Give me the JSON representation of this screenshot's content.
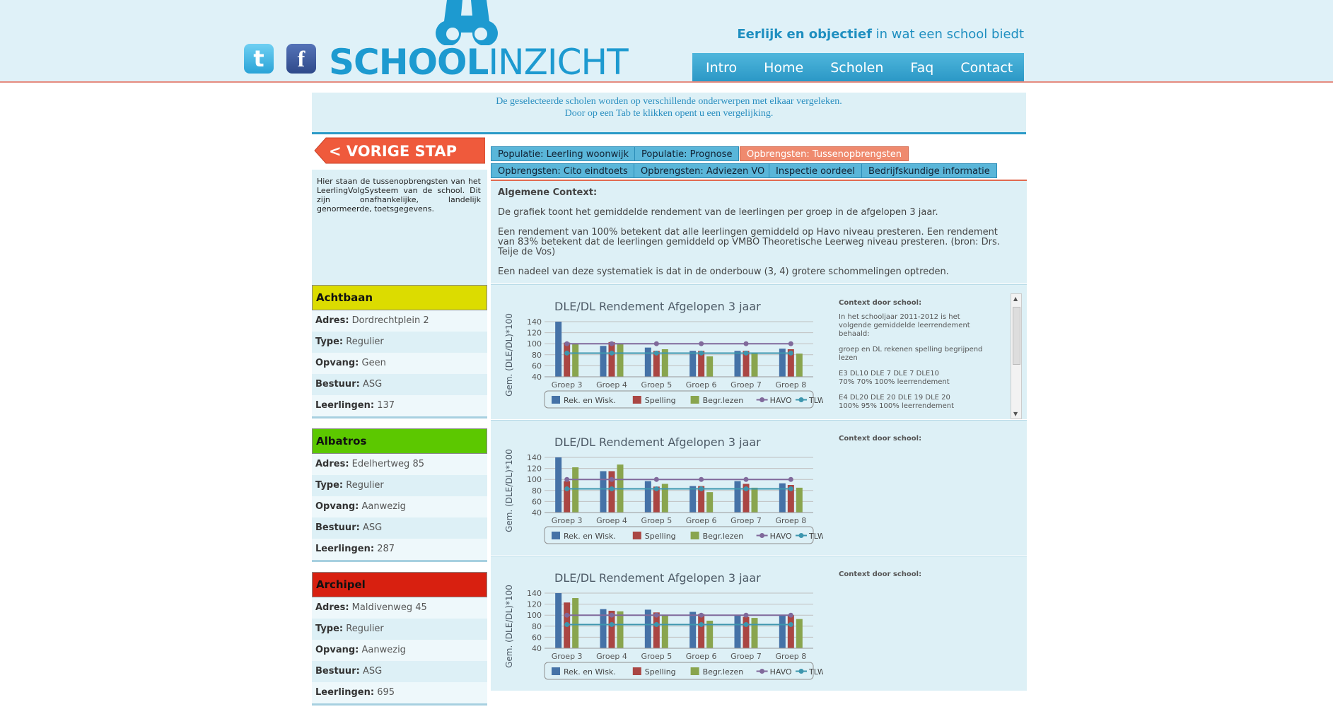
{
  "header": {
    "logo_bold": "SCHOOL",
    "logo_thin": "INZICHT",
    "tagline_bold": "Eerlijk en objectief",
    "tagline_rest": " in wat een school biedt",
    "nav": [
      "Intro",
      "Home",
      "Scholen",
      "Faq",
      "Contact"
    ],
    "social": [
      {
        "icon": "twitter-icon",
        "glyph": "t"
      },
      {
        "icon": "facebook-icon",
        "glyph": "f"
      }
    ],
    "brand_color": "#1d9ad0"
  },
  "intro": {
    "line1": "De geselecteerde scholen worden op verschillende onderwerpen met elkaar vergeleken.",
    "line2": "Door op een Tab te klikken opent u een vergelijking."
  },
  "sidebar": {
    "back_label": "<   VORIGE STAP",
    "description": "Hier staan de tussenopbrengsten van het LeerlingVolgSysteem van de school. Dit zijn onafhankelijke, landelijk genormeerde, toetsgegevens."
  },
  "labels": {
    "adres": "Adres:",
    "type": "Type:",
    "opvang": "Opvang:",
    "bestuur": "Bestuur:",
    "leerlingen": "Leerlingen:"
  },
  "schools": [
    {
      "name": "Achtbaan",
      "color": "#dcdc00",
      "adres": "Dordrechtplein 2",
      "type": "Regulier",
      "opvang": "Geen",
      "bestuur": "ASG",
      "leerlingen": "137"
    },
    {
      "name": "Albatros",
      "color": "#5cc800",
      "adres": "Edelhertweg 85",
      "type": "Regulier",
      "opvang": "Aanwezig",
      "bestuur": "ASG",
      "leerlingen": "287"
    },
    {
      "name": "Archipel",
      "color": "#d82010",
      "adres": "Maldivenweg 45",
      "type": "Regulier",
      "opvang": "Aanwezig",
      "bestuur": "ASG",
      "leerlingen": "695"
    }
  ],
  "tabs": [
    {
      "label": "Populatie: Leerling woonwijk",
      "active": false
    },
    {
      "label": "Populatie: Prognose",
      "active": false
    },
    {
      "label": "Opbrengsten: Tussenopbrengsten",
      "active": true
    },
    {
      "label": "Opbrengsten: Cito eindtoets",
      "active": false
    },
    {
      "label": "Opbrengsten: Adviezen VO",
      "active": false
    },
    {
      "label": "Inspectie oordeel",
      "active": false
    },
    {
      "label": "Bedrijfskundige informatie",
      "active": false
    }
  ],
  "context": {
    "title": "Algemene Context:",
    "p1": "De grafiek toont het gemiddelde rendement van de leerlingen per groep in de afgelopen 3 jaar.",
    "p2": "Een rendement van 100% betekent dat alle leerlingen gemiddeld op Havo niveau presteren. Een rendement van 83% betekent dat de leerlingen gemiddeld op VMBO Theoretische Leerweg niveau presteren. (bron: Drs. Teije de Vos)",
    "p3": "Een nadeel van deze systematiek is dat in de onderbouw (3, 4) grotere schommelingen optreden."
  },
  "school_context": {
    "title": "Context door school:",
    "lines": [
      "In het schooljaar 2011-2012 is het volgende gemiddelde leerrendement behaald:",
      "groep en DL rekenen spelling begrijpend lezen",
      "E3 DL10 DLE 7 DLE 7 DLE10\n70% 70% 100% leerrendement",
      "E4 DL20 DLE 20 DLE 19 DLE 20\n100% 95% 100% leerrendement"
    ]
  },
  "chart_data": [
    {
      "type": "bar",
      "title": "DLE/DL Rendement Afgelopen 3 jaar",
      "ylabel": "Gem. (DLE/DL)*100",
      "ylim": [
        40,
        140
      ],
      "yticks": [
        40,
        60,
        80,
        100,
        120,
        140
      ],
      "categories": [
        "Groep 3",
        "Groep 4",
        "Groep 5",
        "Groep 6",
        "Groep 7",
        "Groep 8"
      ],
      "series": [
        {
          "name": "Rek. en Wisk.",
          "kind": "bar",
          "color": "#4572a7",
          "values": [
            140,
            96,
            93,
            87,
            87,
            91
          ]
        },
        {
          "name": "Spelling",
          "kind": "bar",
          "color": "#aa4643",
          "values": [
            102,
            103,
            87,
            87,
            87,
            90
          ]
        },
        {
          "name": "Begr.lezen",
          "kind": "bar",
          "color": "#89a54e",
          "values": [
            100,
            100,
            90,
            77,
            82,
            82
          ]
        },
        {
          "name": "HAVO",
          "kind": "line",
          "color": "#80699b",
          "values": [
            100,
            100,
            100,
            100,
            100,
            100
          ]
        },
        {
          "name": "TLW",
          "kind": "line",
          "color": "#3d96ae",
          "values": [
            83,
            83,
            83,
            83,
            83,
            83
          ]
        }
      ],
      "legend": "bottom"
    },
    {
      "type": "bar",
      "title": "DLE/DL Rendement Afgelopen 3 jaar",
      "ylabel": "Gem. (DLE/DL)*100",
      "ylim": [
        40,
        140
      ],
      "yticks": [
        40,
        60,
        80,
        100,
        120,
        140
      ],
      "categories": [
        "Groep 3",
        "Groep 4",
        "Groep 5",
        "Groep 6",
        "Groep 7",
        "Groep 8"
      ],
      "series": [
        {
          "name": "Rek. en Wisk.",
          "kind": "bar",
          "color": "#4572a7",
          "values": [
            140,
            115,
            97,
            88,
            97,
            93
          ]
        },
        {
          "name": "Spelling",
          "kind": "bar",
          "color": "#aa4643",
          "values": [
            97,
            115,
            87,
            88,
            92,
            90
          ]
        },
        {
          "name": "Begr.lezen",
          "kind": "bar",
          "color": "#89a54e",
          "values": [
            122,
            127,
            92,
            77,
            85,
            85
          ]
        },
        {
          "name": "HAVO",
          "kind": "line",
          "color": "#80699b",
          "values": [
            100,
            100,
            100,
            100,
            100,
            100
          ]
        },
        {
          "name": "TLW",
          "kind": "line",
          "color": "#3d96ae",
          "values": [
            83,
            83,
            83,
            83,
            83,
            83
          ]
        }
      ],
      "legend": "bottom"
    },
    {
      "type": "bar",
      "title": "DLE/DL Rendement Afgelopen 3 jaar",
      "ylabel": "Gem. (DLE/DL)*100",
      "ylim": [
        40,
        140
      ],
      "yticks": [
        40,
        60,
        80,
        100,
        120,
        140
      ],
      "categories": [
        "Groep 3",
        "Groep 4",
        "Groep 5",
        "Groep 6",
        "Groep 7",
        "Groep 8"
      ],
      "series": [
        {
          "name": "Rek. en Wisk.",
          "kind": "bar",
          "color": "#4572a7",
          "values": [
            140,
            111,
            110,
            106,
            100,
            100
          ]
        },
        {
          "name": "Spelling",
          "kind": "bar",
          "color": "#aa4643",
          "values": [
            123,
            108,
            105,
            102,
            97,
            100
          ]
        },
        {
          "name": "Begr.lezen",
          "kind": "bar",
          "color": "#89a54e",
          "values": [
            131,
            107,
            100,
            90,
            95,
            93
          ]
        },
        {
          "name": "HAVO",
          "kind": "line",
          "color": "#80699b",
          "values": [
            100,
            100,
            100,
            100,
            100,
            100
          ]
        },
        {
          "name": "TLW",
          "kind": "line",
          "color": "#3d96ae",
          "values": [
            83,
            83,
            83,
            83,
            83,
            83
          ]
        }
      ],
      "legend": "bottom"
    }
  ]
}
